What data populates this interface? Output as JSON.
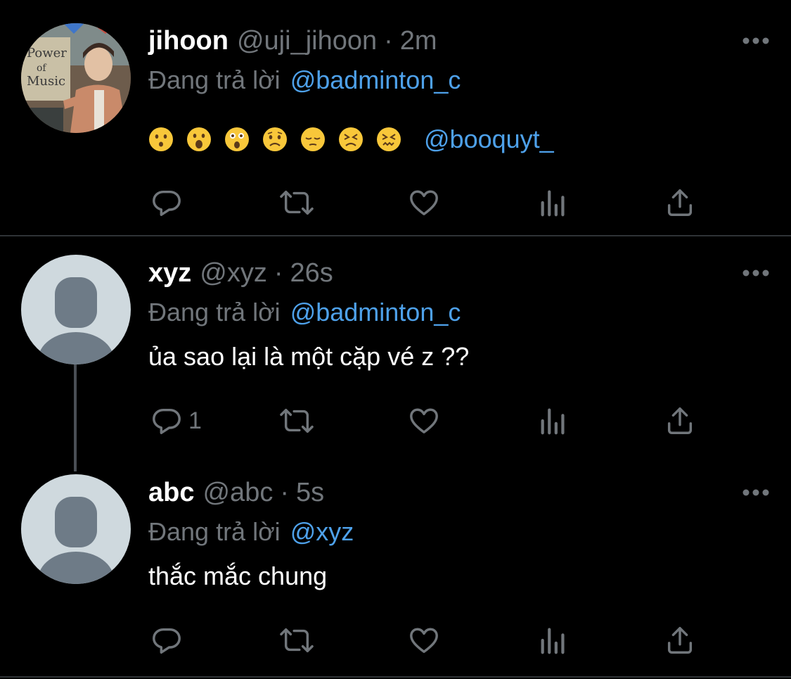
{
  "tweets": [
    {
      "name": "jihoon",
      "handle": "@uji_jihoon",
      "dot": "·",
      "time": "2m",
      "reply_prefix": "Đang trả lời",
      "reply_to": "@badminton_c",
      "mention": "@booquyt_",
      "emojis": [
        "hushed-face",
        "astonished-face-open",
        "astonished-face",
        "worried-face",
        "pensive-face",
        "dizzy-face",
        "confounded-face"
      ],
      "reply_count": ""
    },
    {
      "name": "xyz",
      "handle": "@xyz",
      "dot": "·",
      "time": "26s",
      "reply_prefix": "Đang trả lời",
      "reply_to": "@badminton_c",
      "text": "ủa sao lại là một cặp vé z ??",
      "reply_count": "1"
    },
    {
      "name": "abc",
      "handle": "@abc",
      "dot": "·",
      "time": "5s",
      "reply_prefix": "Đang trả lời",
      "reply_to": "@xyz",
      "text": "thắc mắc chung",
      "reply_count": ""
    }
  ],
  "colors": {
    "background": "#000000",
    "secondary_text": "#71767b",
    "link": "#4ea1ea",
    "divider": "#2f3336",
    "default_avatar_bg": "#cfd9de",
    "default_avatar_fg": "#6e7b87"
  }
}
